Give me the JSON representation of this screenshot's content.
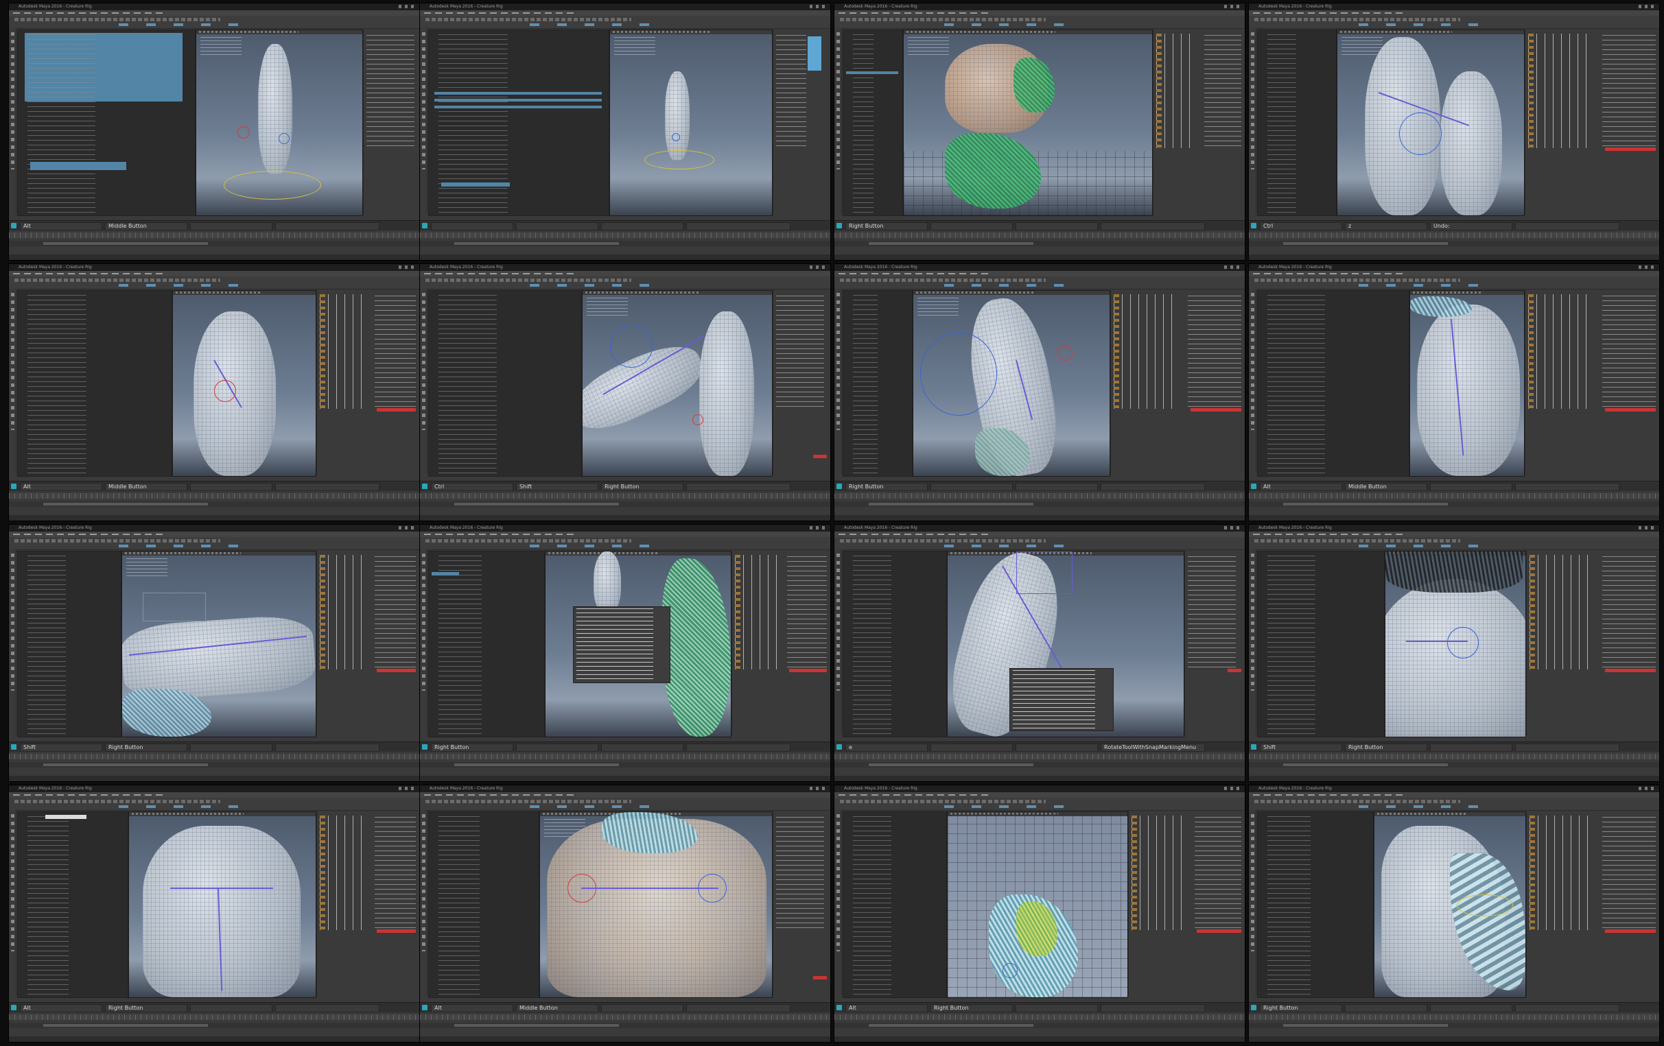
{
  "window_title": "Autodesk Maya 2016 - Creature Rig",
  "tiles": [
    {
      "id": 1,
      "keys": [
        "Alt",
        "Middle Button",
        "",
        ""
      ]
    },
    {
      "id": 2,
      "keys": [
        "",
        "",
        "",
        ""
      ]
    },
    {
      "id": 3,
      "keys": [
        "Right Button",
        "",
        "",
        ""
      ]
    },
    {
      "id": 4,
      "keys": [
        "Ctrl",
        "z",
        "Undo:",
        ""
      ]
    },
    {
      "id": 5,
      "keys": [
        "Alt",
        "Middle Button",
        "",
        ""
      ]
    },
    {
      "id": 6,
      "keys": [
        "Ctrl",
        "Shift",
        "Right Button",
        ""
      ]
    },
    {
      "id": 7,
      "keys": [
        "Right Button",
        "",
        "",
        ""
      ]
    },
    {
      "id": 8,
      "keys": [
        "Alt",
        "Middle Button",
        "",
        ""
      ]
    },
    {
      "id": 9,
      "keys": [
        "Shift",
        "Right Button",
        "",
        ""
      ]
    },
    {
      "id": 10,
      "keys": [
        "Right Button",
        "",
        "",
        ""
      ]
    },
    {
      "id": 11,
      "keys": [
        "e",
        "",
        "",
        "RotateToolWithSnapMarkingMenu"
      ]
    },
    {
      "id": 12,
      "keys": [
        "Shift",
        "Right Button",
        "",
        ""
      ]
    },
    {
      "id": 13,
      "keys": [
        "Alt",
        "Right Button",
        "",
        ""
      ]
    },
    {
      "id": 14,
      "keys": [
        "Alt",
        "Middle Button",
        "",
        ""
      ]
    },
    {
      "id": 15,
      "keys": [
        "Alt",
        "Right Button",
        "",
        ""
      ]
    },
    {
      "id": 16,
      "keys": [
        "Right Button",
        "",
        "",
        ""
      ]
    }
  ]
}
